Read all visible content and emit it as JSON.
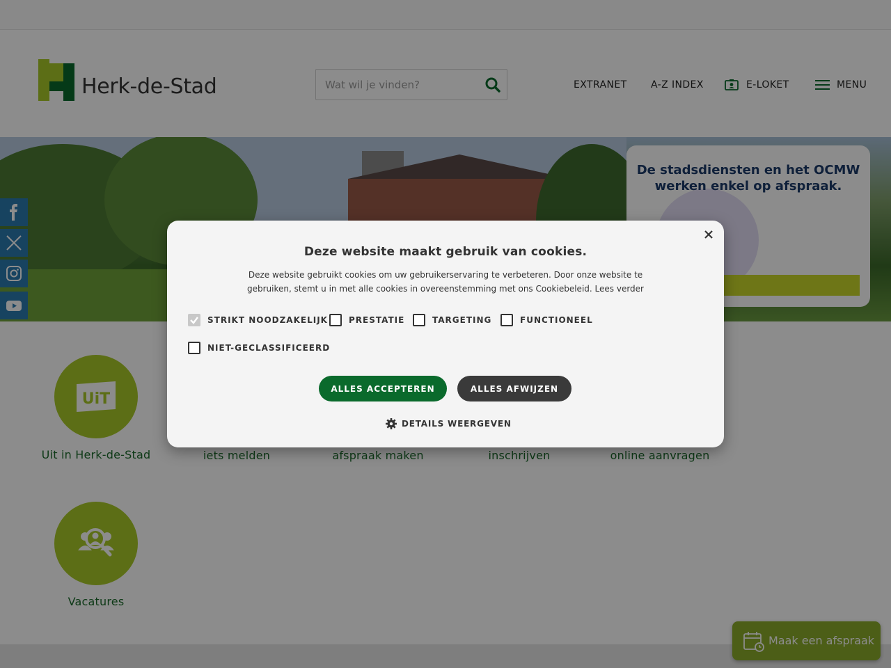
{
  "header": {
    "logo_text": "Herk-de-Stad",
    "search_placeholder": "Wat wil je vinden?",
    "nav": {
      "extranet": "EXTRANET",
      "az_index": "A-Z INDEX",
      "eloket": "E-LOKET",
      "menu": "MENU"
    }
  },
  "hero": {
    "banner_title_line1": "De stadsdiensten en het OCMW",
    "banner_title_line2": "werken enkel op afspraak."
  },
  "social": [
    "facebook-icon",
    "x-twitter-icon",
    "instagram-icon",
    "youtube-icon"
  ],
  "tiles": {
    "row1": [
      {
        "label": "Uit in Herk-de-Stad"
      },
      {
        "label": "iets melden"
      },
      {
        "label": "afspraak maken"
      },
      {
        "label": "inschrijven"
      },
      {
        "label": "online aanvragen"
      }
    ],
    "row2": [
      {
        "label": "Vacatures"
      }
    ]
  },
  "cta": {
    "label": "Maak een afspraak"
  },
  "cookie_modal": {
    "title": "Deze website maakt gebruik van cookies.",
    "description_line1": "Deze website gebruikt cookies om uw gebruikerservaring te verbeteren. Door onze website te",
    "description_line2": "gebruiken, stemt u in met alle cookies in overeenstemming met ons Cookiebeleid.",
    "read_more": "Lees verder",
    "checkboxes": [
      {
        "label": "STRIKT NOODZAKELIJK",
        "checked": true
      },
      {
        "label": "PRESTATIE",
        "checked": false
      },
      {
        "label": "TARGETING",
        "checked": false
      },
      {
        "label": "FUNCTIONEEL",
        "checked": false
      },
      {
        "label": "NIET-GECLASSIFICEERD",
        "checked": false
      }
    ],
    "accept_label": "ALLES ACCEPTEREN",
    "reject_label": "ALLES AFWIJZEN",
    "details_label": "DETAILS WEERGEVEN"
  },
  "colors": {
    "brand_green": "#0a6a2c",
    "tile_green": "#a8c828",
    "label_green": "#1a6a2a"
  }
}
